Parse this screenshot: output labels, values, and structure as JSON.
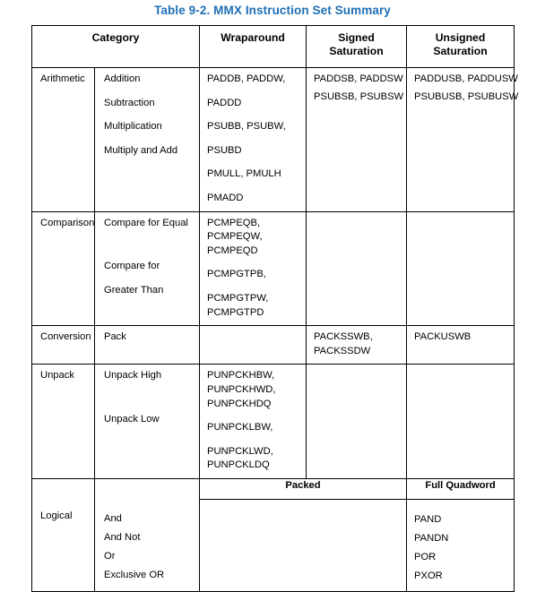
{
  "title": "Table 9-2.  MMX Instruction Set Summary",
  "title_color": "#1F6FB5",
  "header": {
    "category": "Category",
    "wraparound": "Wraparound",
    "signed_saturation_line1": "Signed",
    "signed_saturation_line2": "Saturation",
    "unsigned_saturation": "Unsigned Saturation"
  },
  "subheader": {
    "packed": "Packed",
    "full_quadword": "Full Quadword"
  },
  "rows": {
    "arithmetic": {
      "group": "Arithmetic",
      "operations": [
        "Addition",
        "Subtraction",
        "Multiplication",
        "Multiply and Add"
      ],
      "wraparound": [
        "PADDB, PADDW,",
        "PADDD",
        "PSUBB, PSUBW,",
        "PSUBD",
        "PMULL, PMULH",
        "PMADD"
      ],
      "signed": [
        "PADDSB, PADDSW",
        "PSUBSB, PSUBSW"
      ],
      "unsigned": [
        "PADDUSB, PADDUSW",
        "PSUBUSB, PSUBUSW"
      ]
    },
    "comparison": {
      "group": "Comparison",
      "op1": "Compare for Equal",
      "op2_line1": "Compare for",
      "op2_line2": "Greater Than",
      "wrap1": [
        "PCMPEQB,",
        "PCMPEQW,",
        "PCMPEQD"
      ],
      "wrap2": [
        "PCMPGTPB,",
        "PCMPGTPW,",
        "PCMPGTPD"
      ],
      "signed": "",
      "unsigned": ""
    },
    "conversion": {
      "group": "Conversion",
      "operation": "Pack",
      "wraparound": "",
      "signed": [
        "PACKSSWB,",
        "PACKSSDW"
      ],
      "unsigned": "PACKUSWB"
    },
    "unpack": {
      "group": "Unpack",
      "op1": "Unpack High",
      "op2": "Unpack Low",
      "wrap1": [
        "PUNPCKHBW,",
        "PUNPCKHWD,",
        "PUNPCKHDQ"
      ],
      "wrap2": [
        "PUNPCKLBW,",
        "PUNPCKLWD,",
        "PUNPCKLDQ"
      ],
      "signed": "",
      "unsigned": ""
    },
    "logical": {
      "group": "Logical",
      "operations": [
        "And",
        "And Not",
        "Or",
        "Exclusive OR"
      ],
      "packed": "",
      "full_quadword": [
        "PAND",
        "PANDN",
        "POR",
        "PXOR"
      ]
    }
  }
}
